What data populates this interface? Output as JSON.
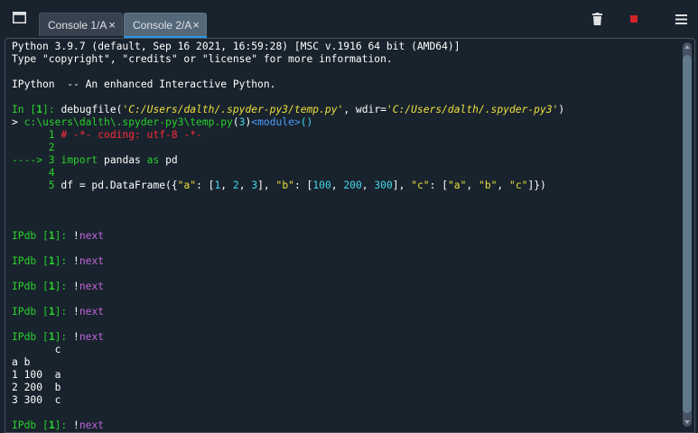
{
  "tabs": [
    {
      "label": "Console 1/A",
      "close": "×"
    },
    {
      "label": "Console 2/A",
      "close": "×"
    }
  ],
  "toolbar": {
    "left_icon": "window-icon",
    "right_icons": [
      "trash-icon",
      "stop-icon",
      "hamburger-menu-icon"
    ]
  },
  "colors": {
    "background": "#19232d",
    "tab_accent": "#259ae9",
    "stop": "#d4232a",
    "prompt_green": "#29d12d",
    "magic_purple": "#c065db",
    "string_yellow": "#ece03d",
    "number_cyan": "#40d7e8",
    "comment_red": "#ff2a39",
    "arrow_orange": "#ffb43a"
  },
  "console_lines": [
    [
      {
        "t": "Python 3.9.7 (default, Sep 16 2021, 16:59:28) [MSC v.1916 64 bit (AMD64)]"
      }
    ],
    [
      {
        "t": "Type \"copyright\", \"credits\" or \"license\" for more information."
      }
    ],
    [],
    [
      {
        "t": "IPython  -- An enhanced Interactive Python."
      }
    ],
    [],
    [
      {
        "t": "In [",
        "c": "grn"
      },
      {
        "t": "1",
        "c": "grnb"
      },
      {
        "t": "]: ",
        "c": "grn"
      },
      {
        "t": "debugfile("
      },
      {
        "t": "'C:/Users/dalth/.spyder-py3/temp.py'",
        "c": "yel",
        "i": true
      },
      {
        "t": ", wdir="
      },
      {
        "t": "'C:/Users/dalth/.spyder-py3'",
        "c": "yel",
        "i": true
      },
      {
        "t": ")"
      }
    ],
    [
      {
        "t": "> "
      },
      {
        "t": "c:\\users\\dalth\\.spyder-py3\\temp.py",
        "c": "grn"
      },
      {
        "t": "("
      },
      {
        "t": "3",
        "c": "cya"
      },
      {
        "t": ")"
      },
      {
        "t": "<module>",
        "c": "blu"
      },
      {
        "t": "()",
        "c": "cya"
      }
    ],
    [
      {
        "t": "      1 ",
        "c": "grn"
      },
      {
        "t": "# -*- coding: utf-8 -*-",
        "c": "red"
      }
    ],
    [
      {
        "t": "      2",
        "c": "grn"
      }
    ],
    [
      {
        "t": "----> 3 ",
        "c": "grn"
      },
      {
        "t": "import",
        "c": "grn"
      },
      {
        "t": " pandas "
      },
      {
        "t": "as",
        "c": "grn"
      },
      {
        "t": " pd"
      }
    ],
    [
      {
        "t": "      4",
        "c": "grn"
      }
    ],
    [
      {
        "t": "      5 ",
        "c": "grn"
      },
      {
        "t": "df = pd.DataFrame({"
      },
      {
        "t": "\"a\"",
        "c": "yel"
      },
      {
        "t": ": ["
      },
      {
        "t": "1",
        "c": "cya"
      },
      {
        "t": ", "
      },
      {
        "t": "2",
        "c": "cya"
      },
      {
        "t": ", "
      },
      {
        "t": "3",
        "c": "cya"
      },
      {
        "t": "], "
      },
      {
        "t": "\"b\"",
        "c": "yel"
      },
      {
        "t": ": ["
      },
      {
        "t": "100",
        "c": "cya"
      },
      {
        "t": ", "
      },
      {
        "t": "200",
        "c": "cya"
      },
      {
        "t": ", "
      },
      {
        "t": "300",
        "c": "cya"
      },
      {
        "t": "], "
      },
      {
        "t": "\"c\"",
        "c": "yel"
      },
      {
        "t": ": ["
      },
      {
        "t": "\"a\"",
        "c": "yel"
      },
      {
        "t": ", "
      },
      {
        "t": "\"b\"",
        "c": "yel"
      },
      {
        "t": ", "
      },
      {
        "t": "\"c\"",
        "c": "yel"
      },
      {
        "t": "]})"
      }
    ],
    [],
    [],
    [],
    [
      {
        "t": "IPdb [",
        "c": "grn"
      },
      {
        "t": "1",
        "c": "grnb"
      },
      {
        "t": "]: ",
        "c": "grn"
      },
      {
        "t": "!"
      },
      {
        "t": "next",
        "c": "pur"
      }
    ],
    [],
    [
      {
        "t": "IPdb [",
        "c": "grn"
      },
      {
        "t": "1",
        "c": "grnb"
      },
      {
        "t": "]: ",
        "c": "grn"
      },
      {
        "t": "!"
      },
      {
        "t": "next",
        "c": "pur"
      }
    ],
    [],
    [
      {
        "t": "IPdb [",
        "c": "grn"
      },
      {
        "t": "1",
        "c": "grnb"
      },
      {
        "t": "]: ",
        "c": "grn"
      },
      {
        "t": "!"
      },
      {
        "t": "next",
        "c": "pur"
      }
    ],
    [],
    [
      {
        "t": "IPdb [",
        "c": "grn"
      },
      {
        "t": "1",
        "c": "grnb"
      },
      {
        "t": "]: ",
        "c": "grn"
      },
      {
        "t": "!"
      },
      {
        "t": "next",
        "c": "pur"
      }
    ],
    [],
    [
      {
        "t": "IPdb [",
        "c": "grn"
      },
      {
        "t": "1",
        "c": "grnb"
      },
      {
        "t": "]: ",
        "c": "grn"
      },
      {
        "t": "!"
      },
      {
        "t": "next",
        "c": "pur"
      }
    ],
    [
      {
        "t": "       c"
      }
    ],
    [
      {
        "t": "a b"
      }
    ],
    [
      {
        "t": "1 100  a"
      }
    ],
    [
      {
        "t": "2 200  b"
      }
    ],
    [
      {
        "t": "3 300  c"
      }
    ],
    [],
    [
      {
        "t": "IPdb [",
        "c": "grn"
      },
      {
        "t": "1",
        "c": "grnb"
      },
      {
        "t": "]: ",
        "c": "grn"
      },
      {
        "t": "!"
      },
      {
        "t": "next",
        "c": "pur"
      }
    ]
  ]
}
